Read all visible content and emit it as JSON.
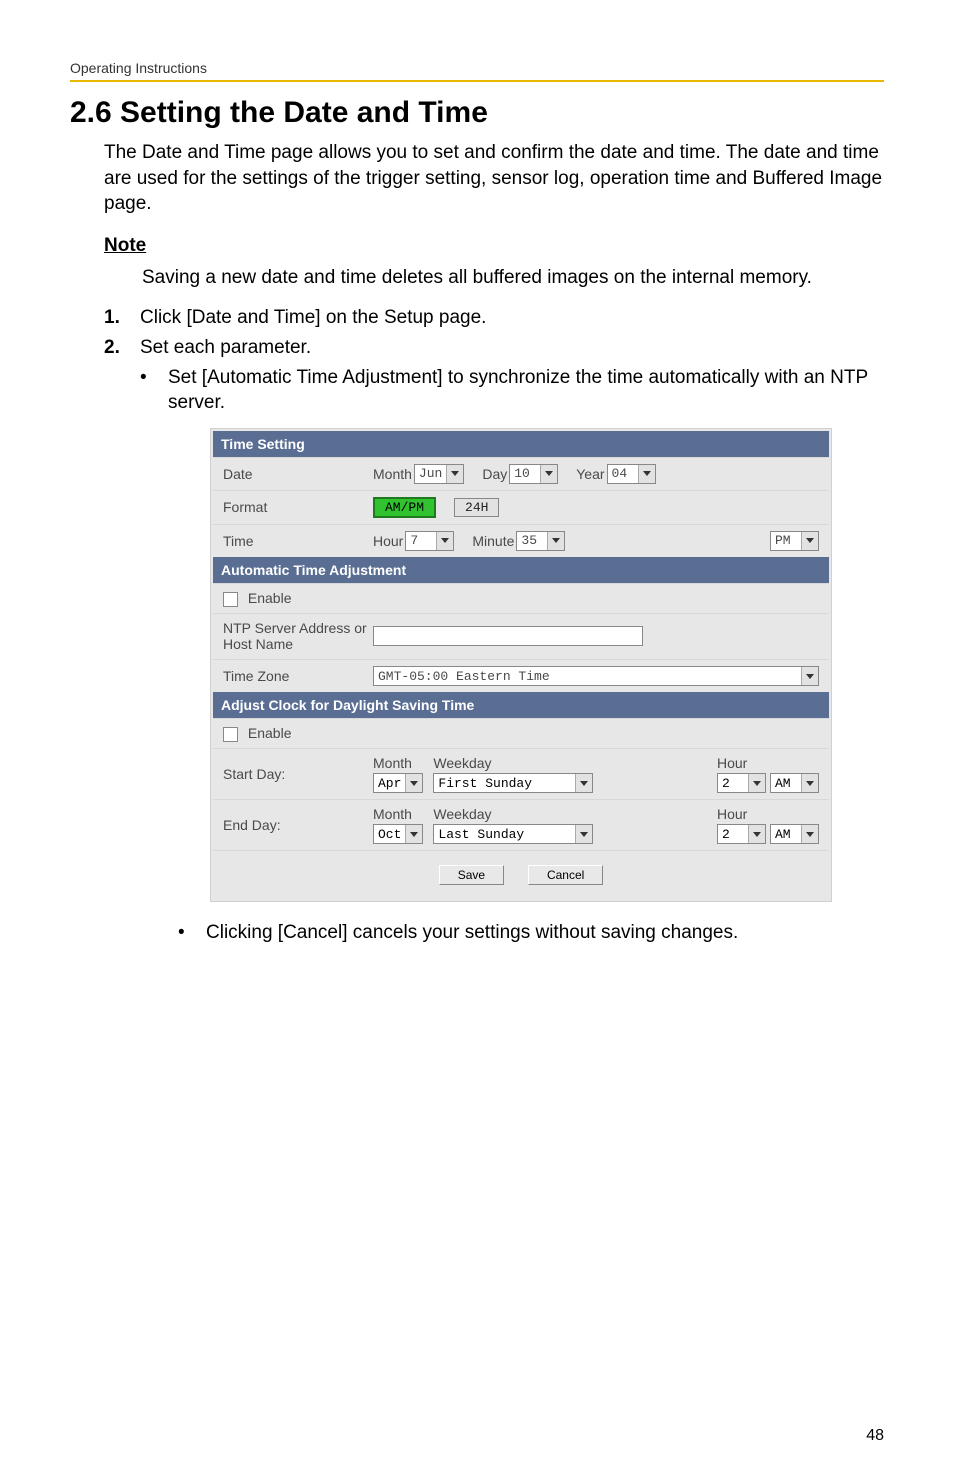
{
  "header": "Operating Instructions",
  "title": "2.6   Setting the Date and Time",
  "intro": "The Date and Time page allows you to set and confirm the date and time. The date and time are used for the settings of the trigger setting, sensor log, operation time and Buffered Image page.",
  "note_heading": "Note",
  "note_text": "Saving a new date and time deletes all buffered images on the internal memory.",
  "steps": {
    "s1_num": "1.",
    "s1_text": "Click [Date and Time] on the Setup page.",
    "s2_num": "2.",
    "s2_text": "Set each parameter.",
    "s2_sub": "Set [Automatic Time Adjustment] to synchronize the time automatically with an NTP server."
  },
  "panel": {
    "time_setting_header": "Time Setting",
    "date_label": "Date",
    "month_label": "Month",
    "month_val": "Jun",
    "day_label": "Day",
    "day_val": "10",
    "year_label": "Year",
    "year_val": "04",
    "format_label": "Format",
    "ampm_btn": "AM/PM",
    "h24_btn": "24H",
    "time_label": "Time",
    "hour_label": "Hour",
    "hour_val": "7",
    "minute_label": "Minute",
    "minute_val": "35",
    "pm_val": "PM",
    "auto_header": "Automatic Time Adjustment",
    "enable_label": "Enable",
    "ntp_label": "NTP Server Address or Host Name",
    "tz_label": "Time Zone",
    "tz_val": "GMT-05:00 Eastern Time",
    "dst_header": "Adjust Clock for Daylight Saving Time",
    "dst_enable_label": "Enable",
    "start_label": "Start Day:",
    "end_label": "End Day:",
    "col_month": "Month",
    "col_weekday": "Weekday",
    "col_hour": "Hour",
    "start_month": "Apr",
    "start_weekday": "First Sunday",
    "start_hour": "2",
    "start_ampm": "AM",
    "end_month": "Oct",
    "end_weekday": "Last Sunday",
    "end_hour": "2",
    "end_ampm": "AM",
    "save_btn": "Save",
    "cancel_btn": "Cancel"
  },
  "post_bullet": "Clicking [Cancel] cancels your settings without saving changes.",
  "page_number": "48"
}
